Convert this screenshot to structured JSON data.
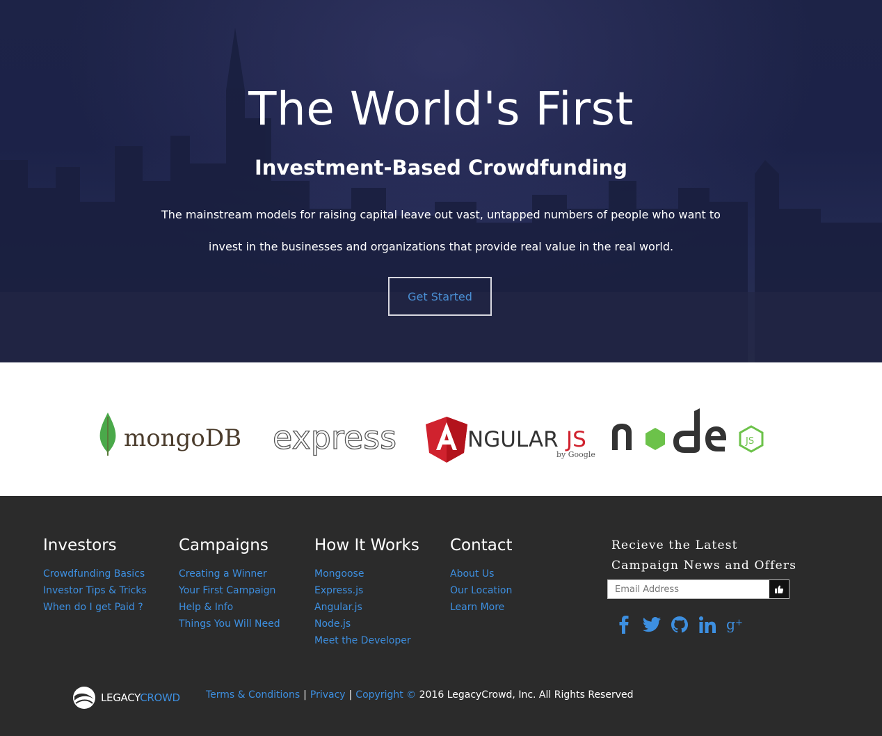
{
  "hero": {
    "title": "The World's First",
    "subtitle": "Investment-Based Crowdfunding",
    "description": "The mainstream models for raising capital leave out vast, untapped numbers of people who want to invest in the businesses and organizations that provide real value in the real world.",
    "cta_label": "Get Started"
  },
  "logos": {
    "mongodb": "mongoDB",
    "express": "express",
    "angular": "NGULAR",
    "angular_js": "JS",
    "angular_by": "by Google",
    "node": "node"
  },
  "footer": {
    "columns": [
      {
        "title": "Investors",
        "links": [
          "Crowdfunding Basics",
          "Investor Tips & Tricks",
          "When do I get Paid ?"
        ]
      },
      {
        "title": "Campaigns",
        "links": [
          "Creating a Winner",
          "Your First Campaign",
          "Help & Info",
          "Things You Will Need"
        ]
      },
      {
        "title": "How It Works",
        "links": [
          "Mongoose",
          "Express.js",
          "Angular.js",
          "Node.js",
          "Meet the Developer"
        ]
      },
      {
        "title": "Contact",
        "links": [
          "About Us",
          "Our Location",
          "Learn More"
        ]
      }
    ],
    "newsletter": {
      "title_line1": "Recieve the Latest",
      "title_line2": "Campaign News and Offers",
      "email_placeholder": "Email Address"
    },
    "social_icons": [
      "facebook-icon",
      "twitter-icon",
      "github-icon",
      "linkedin-icon",
      "google-plus-icon"
    ],
    "brand": {
      "part1": "LEGACY",
      "part2": "CROWD"
    },
    "bottom": {
      "terms": "Terms & Conditions",
      "privacy": "Privacy",
      "copyright_link": "Copyright ©",
      "copyright_text": "2016 LegacyCrowd, Inc. All Rights Reserved"
    }
  },
  "colors": {
    "accent": "#3d8fe0",
    "footer_bg": "#2b2b2b",
    "hero_bg": "#1d2347"
  }
}
